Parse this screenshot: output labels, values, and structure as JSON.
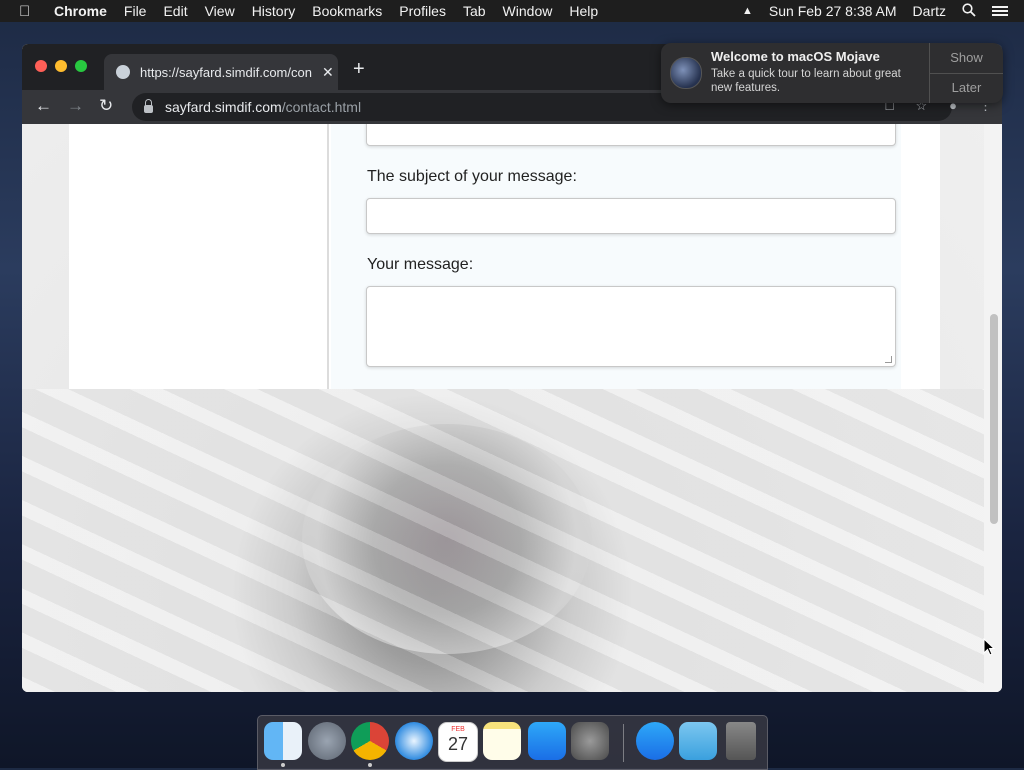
{
  "menubar": {
    "app_name": "Chrome",
    "menus": [
      "File",
      "Edit",
      "View",
      "History",
      "Bookmarks",
      "Profiles",
      "Tab",
      "Window",
      "Help"
    ],
    "datetime": "Sun Feb 27  8:38 AM",
    "user": "Dartz"
  },
  "browser": {
    "tab_title": "https://sayfard.simdif.com/con",
    "url_host": "sayfard.simdif.com",
    "url_path": "/contact.html"
  },
  "form": {
    "subject_label": "The subject of your message:",
    "message_label": "Your message:"
  },
  "notification": {
    "title": "Welcome to macOS Mojave",
    "body": "Take a quick tour to learn about great new features.",
    "show_label": "Show",
    "later_label": "Later"
  },
  "dock": {
    "calendar_day": "27",
    "calendar_month": "FEB"
  },
  "colors": {
    "menubar": "#1e1e1e",
    "chrome_dark": "#35363a",
    "close": "#ff5f57",
    "minimize": "#febc2e",
    "zoom": "#28c840"
  }
}
